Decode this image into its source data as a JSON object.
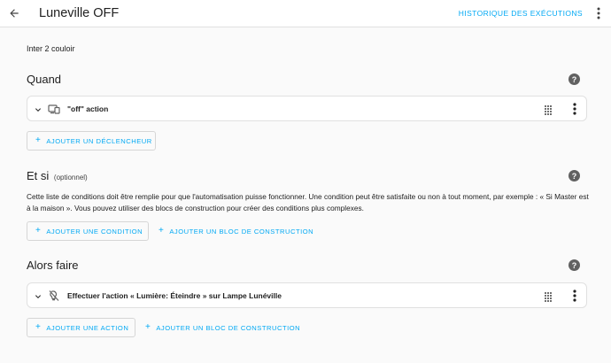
{
  "header": {
    "title": "Luneville OFF",
    "history_label": "HISTORIQUE DES EXÉCUTIONS"
  },
  "description": "Inter 2 couloir",
  "triggers": {
    "title": "Quand",
    "help": "?",
    "items": [
      {
        "label": "\"off\" action",
        "icon": "remote-device-icon"
      }
    ],
    "add_label": "AJOUTER UN DÉCLENCHEUR"
  },
  "conditions": {
    "title": "Et si",
    "optional": "(optionnel)",
    "help": "?",
    "text": "Cette liste de conditions doit être remplie pour que l'automatisation puisse fonctionner. Une condition peut être satisfaite ou non à tout moment, par exemple : « Si Master est à la maison ». Vous pouvez utiliser des blocs de construction pour créer des conditions plus complexes.",
    "add_label": "AJOUTER UNE CONDITION",
    "add_block_label": "AJOUTER UN BLOC DE CONSTRUCTION"
  },
  "actions": {
    "title": "Alors faire",
    "help": "?",
    "items": [
      {
        "label": "Effectuer l'action « Lumière: Éteindre » sur Lampe Lunéville",
        "icon": "service-icon"
      }
    ],
    "add_label": "AJOUTER UNE ACTION",
    "add_block_label": "AJOUTER UN BLOC DE CONSTRUCTION"
  },
  "colors": {
    "accent": "#03a9f4",
    "background": "#fafafa",
    "card": "#ffffff",
    "text": "#212121",
    "help_icon": "#616161"
  }
}
